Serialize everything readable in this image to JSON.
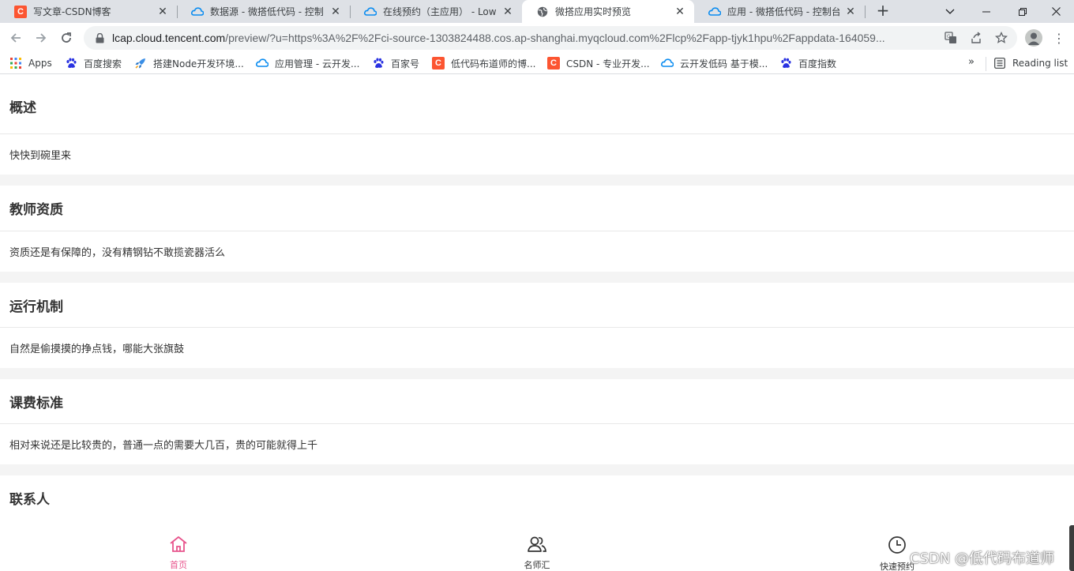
{
  "browser": {
    "tabs": [
      {
        "title": "写文章-CSDN博客",
        "favicon": "csdn-icon"
      },
      {
        "title": "数据源 - 微搭低代码 - 控制台",
        "favicon": "tencent-cloud-icon"
      },
      {
        "title": "在线预约（主应用） - LowC",
        "favicon": "tencent-cloud-icon"
      },
      {
        "title": "微搭应用实时预览",
        "favicon": "globe-icon"
      },
      {
        "title": "应用 - 微搭低代码 - 控制台",
        "favicon": "tencent-cloud-icon"
      }
    ],
    "active_tab": 3,
    "url_host": "lcap.cloud.tencent.com",
    "url_path": "/preview/?u=https%3A%2F%2Fci-source-1303824488.cos.ap-shanghai.myqcloud.com%2Flcp%2Fapp-tjyk1hpu%2Fappdata-164059...",
    "bookmarks": [
      {
        "label": "Apps",
        "icon": "apps-grid-icon"
      },
      {
        "label": "百度搜索",
        "icon": "baidu-icon"
      },
      {
        "label": "搭建Node开发环境...",
        "icon": "rocket-icon"
      },
      {
        "label": "应用管理 - 云开发...",
        "icon": "tencent-cloud-icon"
      },
      {
        "label": "百家号",
        "icon": "baidu-icon"
      },
      {
        "label": "低代码布道师的博...",
        "icon": "csdn-icon"
      },
      {
        "label": "CSDN - 专业开发...",
        "icon": "csdn-icon"
      },
      {
        "label": "云开发低码 基于模...",
        "icon": "tencent-cloud-icon"
      },
      {
        "label": "百度指数",
        "icon": "baidu-icon"
      }
    ],
    "more_bookmarks": "»",
    "reading_list": "Reading list"
  },
  "sections": [
    {
      "title": "概述",
      "body": "快快到碗里来"
    },
    {
      "title": "教师资质",
      "body": "资质还是有保障的，没有精钢钻不敢揽瓷器活么"
    },
    {
      "title": "运行机制",
      "body": "自然是偷摸摸的挣点钱，哪能大张旗鼓"
    },
    {
      "title": "课费标准",
      "body": "相对来说还是比较贵的，普通一点的需要大几百，贵的可能就得上千"
    },
    {
      "title": "联系人",
      "body": ""
    }
  ],
  "tabbar": [
    {
      "label": "首页",
      "icon": "home-icon",
      "active": true
    },
    {
      "label": "名师汇",
      "icon": "users-icon",
      "active": false
    },
    {
      "label": "快速预约",
      "icon": "clock-icon",
      "active": false
    }
  ],
  "watermark": "CSDN @低代码布道师",
  "colors": {
    "accent": "#e8548c",
    "section_gap": "#f4f4f4",
    "csdn": "#fc5531",
    "tencent_cloud": "#0a8cf0",
    "baidu": "#2932e1"
  }
}
